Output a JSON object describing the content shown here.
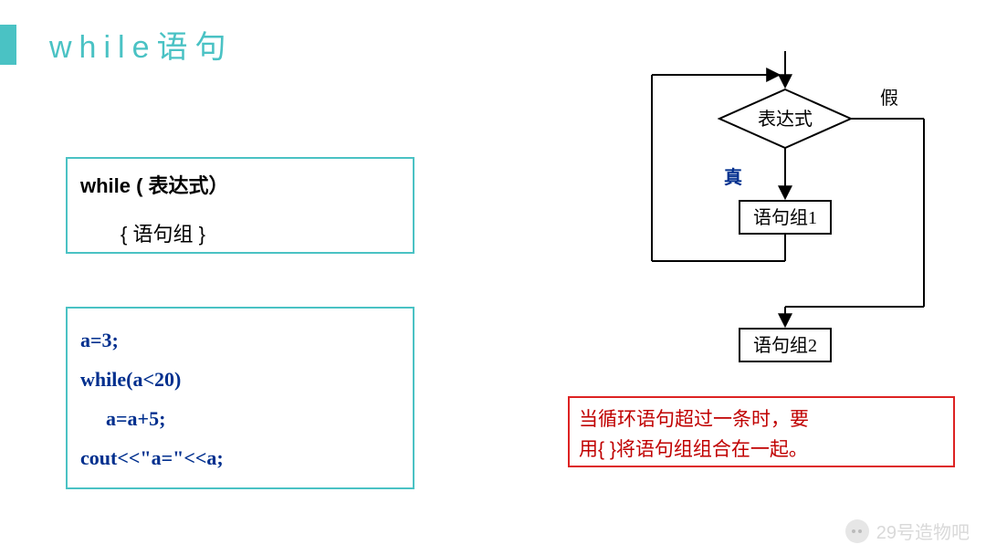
{
  "title": "while语句",
  "syntax": {
    "line1": "while ( 表达式）",
    "line2": "{ 语句组 }"
  },
  "code": {
    "l1": "a=3;",
    "l2": "while(a<20)",
    "l3": "a=a+5;",
    "l4": "cout<<\"a=\"<<a;"
  },
  "flow": {
    "decision": "表达式",
    "true_label": "真",
    "false_label": "假",
    "block1": "语句组1",
    "block2": "语句组2"
  },
  "note": {
    "l1": "当循环语句超过一条时，要",
    "l2": "用{ }将语句组组合在一起。"
  },
  "watermark": "29号造物吧"
}
